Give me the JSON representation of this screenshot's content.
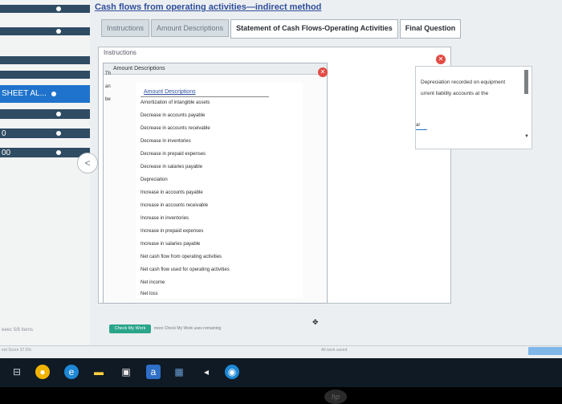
{
  "left_strip": {
    "sheet_label": "SHEET AL...",
    "row_label_1": "0",
    "row_label_2": "00",
    "gray_text": "eeec 5/8 itema"
  },
  "page": {
    "title": "Cash flows from operating activities—indirect method"
  },
  "tabs": [
    {
      "label": "Instructions"
    },
    {
      "label": "Amount Descriptions"
    },
    {
      "label": "Statement of Cash Flows-Operating Activities"
    },
    {
      "label": "Final Question"
    }
  ],
  "outer_window": {
    "label": "Instructions"
  },
  "popup": {
    "title": "Amount Descriptions",
    "frag_th": "Th",
    "frag_an": "an",
    "frag_be": "be"
  },
  "list": {
    "header": "Amount Descriptions",
    "items": [
      "Amortization of intangible assets",
      "Decrease in accounts payable",
      "Decrease in accounts receivable",
      "Decrease in inventories",
      "Decrease in prepaid expenses",
      "Decrease in salaries payable",
      "Depreciation",
      "Increase in accounts payable",
      "Increase in accounts receivable",
      "Increase in inventories",
      "Increase in prepaid expenses",
      "Increase in salaries payable",
      "Net cash flow from operating activities",
      "Net cash flow used for operating activities",
      "Net income",
      "Net loss"
    ]
  },
  "right_panel": {
    "line1": "Depreciation recorded on equipment",
    "line2": "urrent liability accounts at the",
    "yr": "ar"
  },
  "check": {
    "button_label": "Check My Work",
    "note": "more Check My Work uses remaining"
  },
  "footer": {
    "left": "ent Score 37.5%",
    "right": "All work saved."
  },
  "bottom_left": "eeec 5/8 items",
  "taskbar": {
    "a_label": "a"
  }
}
